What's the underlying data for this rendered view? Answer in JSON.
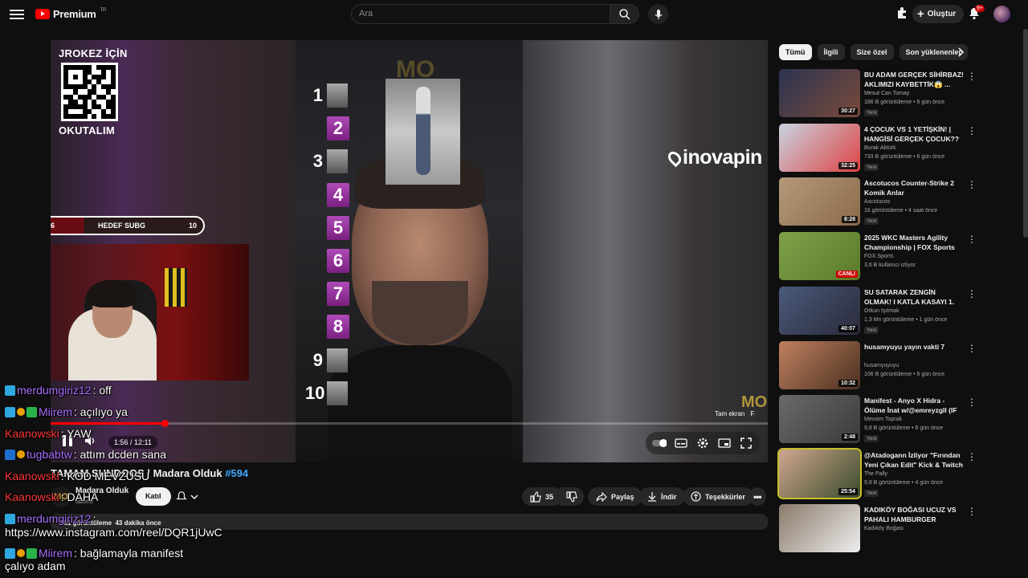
{
  "header": {
    "logo_text": "Premium",
    "region": "TR",
    "search_placeholder": "Ara",
    "create_label": "Oluştur",
    "notif_count": "9+"
  },
  "player": {
    "qr_title": "JROKEZ İÇİN",
    "qr_subtitle": "OKUTALIM",
    "goal_left": "6",
    "goal_label": "HEDEF SUBG",
    "goal_right": "10",
    "goal_progress": 0.25,
    "ranks": [
      "1",
      "2",
      "3",
      "4",
      "5",
      "6",
      "7",
      "8",
      "9",
      "10"
    ],
    "brand": "inovapin",
    "watermark": "MO",
    "fullscreen_tip": "Tam ekran",
    "fullscreen_key": "F",
    "time_label": "1:56 / 12:11",
    "progress": 0.159
  },
  "chat": [
    {
      "user": "merdumgiriz12",
      "text": ": off",
      "color": "#a970ff",
      "badges": [
        "#2ea8e0"
      ]
    },
    {
      "user": "Miirem",
      "text": ": açılıyo ya",
      "color": "#a970ff",
      "badges": [
        "#2ea8e0",
        "#e8a000",
        "#29b34a"
      ]
    },
    {
      "user": "Kaanowski",
      "text": ": YAW",
      "color": "#ff3838",
      "badges": []
    },
    {
      "user": "tugbabtw",
      "text": ": attım dcden sana",
      "color": "#a970ff",
      "badges": [
        "#1f6fd0",
        "#e8a000"
      ]
    },
    {
      "user": "Kaanowski",
      "text": ": KOD MEVZUSU",
      "color": "#ff3838",
      "badges": []
    },
    {
      "user": "Kaanowski",
      "text": ": DAHA",
      "color": "#ff3838",
      "badges": []
    },
    {
      "user": "merdumgiriz12",
      "text": ":",
      "color": "#a970ff",
      "badges": [
        "#2ea8e0"
      ]
    },
    {
      "user": "",
      "text": "https://www.instagram.com/reel/DQR1jUwC",
      "color": "#ffffff",
      "badges": []
    },
    {
      "user": "Miirem",
      "text": ": bağlamayla manifest",
      "color": "#a970ff",
      "badges": [
        "#2ea8e0",
        "#e8a000",
        "#29b34a"
      ]
    },
    {
      "user": "",
      "text": "çalıyo adam",
      "color": "#ffffff",
      "badges": []
    }
  ],
  "video": {
    "title_pre": "TAMAM SUNDOOS | Madara Olduk ",
    "title_tag": "#594",
    "channel_initials": "MO",
    "channel": "Madara Olduk",
    "subs": "abone",
    "join_label": "Katıl",
    "likes": "35",
    "share_label": "Paylaş",
    "download_label": "İndir",
    "thanks_label": "Teşekkürler",
    "desc_views": "381 görüntüleme",
    "desc_time": "43 dakika önce"
  },
  "chips": [
    "Tümü",
    "İlgili",
    "Size özel",
    "Son yüklenenler"
  ],
  "recs": [
    {
      "title": "BU ADAM GERÇEK SİHİRBAZ! AKLIMIZI KAYBETTİK😱 ...",
      "channel": "Mesut Can Tomay",
      "meta": "186 B görüntüleme • 6 gün önce",
      "new": "Yeni",
      "dur": "30:27",
      "c1": "#2a3350",
      "c2": "#7a4a3a"
    },
    {
      "title": "4 ÇOCUK VS 1 YETİŞKİN! | HANGİSİ GERÇEK ÇOCUK?? ...",
      "channel": "Burak Aktürk",
      "meta": "733 B görüntüleme • 6 gün önce",
      "new": "Yeni",
      "dur": "32:25",
      "c1": "#c9d3e0",
      "c2": "#d44"
    },
    {
      "title": "Ascotucos Counter-Strike 2 Komik Anlar",
      "channel": "Ascotucos",
      "meta": "16 görüntüleme • 4 saat önce",
      "new": "Yeni",
      "dur": "8:28",
      "c1": "#b49a7a",
      "c2": "#8a6a4a"
    },
    {
      "title": "2025 WKC Masters Agility Championship | FOX Sports",
      "channel": "FOX Sports",
      "meta": "3,6 B kullanıcı izliyor",
      "new": "",
      "dur": "",
      "live": "CANLI",
      "c1": "#7fa04a",
      "c2": "#5a7a2a"
    },
    {
      "title": "SU SATARAK ZENGİN OLMAK! I KATLA KASAYI 1. BÖLÜM ...",
      "channel": "Orkun Işıtmak",
      "meta": "1,3 Mn görüntüleme • 1 gün önce",
      "new": "Yeni",
      "dur": "40:07",
      "c1": "#4a5a7a",
      "c2": "#2a2a3a"
    },
    {
      "title": "husamyuyu yayın vakti 7",
      "channel": "husamyuyuyu",
      "meta": "106 B görüntüleme • 6 gün önce",
      "new": "",
      "dur": "10:32",
      "c1": "#c08060",
      "c2": "#4a3020"
    },
    {
      "title": "Manifest - Anyo X Hidra - Ölüme İnat w/@emreyzgll (IF ...",
      "channel": "Mevsim Toprak",
      "meta": "9,8 B görüntüleme • 6 gün önce",
      "new": "Yeni",
      "dur": "2:48",
      "c1": "#6a6a6a",
      "c2": "#3a3a3a"
    },
    {
      "title": "@Atadogann İzliyor \"Fırından Yeni Çıkan Edit\" Kick & Twitch ...",
      "channel": "The Pally",
      "meta": "9,8 B görüntüleme • 4 gün önce",
      "new": "Yeni",
      "dur": "25:54",
      "c1": "#d0a890",
      "c2": "#3a4a2a"
    },
    {
      "title": "KADIKÖY BOĞASI UCUZ VS PAHALI HAMBURGER",
      "channel": "Kadıköy Boğası",
      "meta": "",
      "new": "",
      "dur": "",
      "c1": "#8a7a6a",
      "c2": "#eee"
    }
  ]
}
